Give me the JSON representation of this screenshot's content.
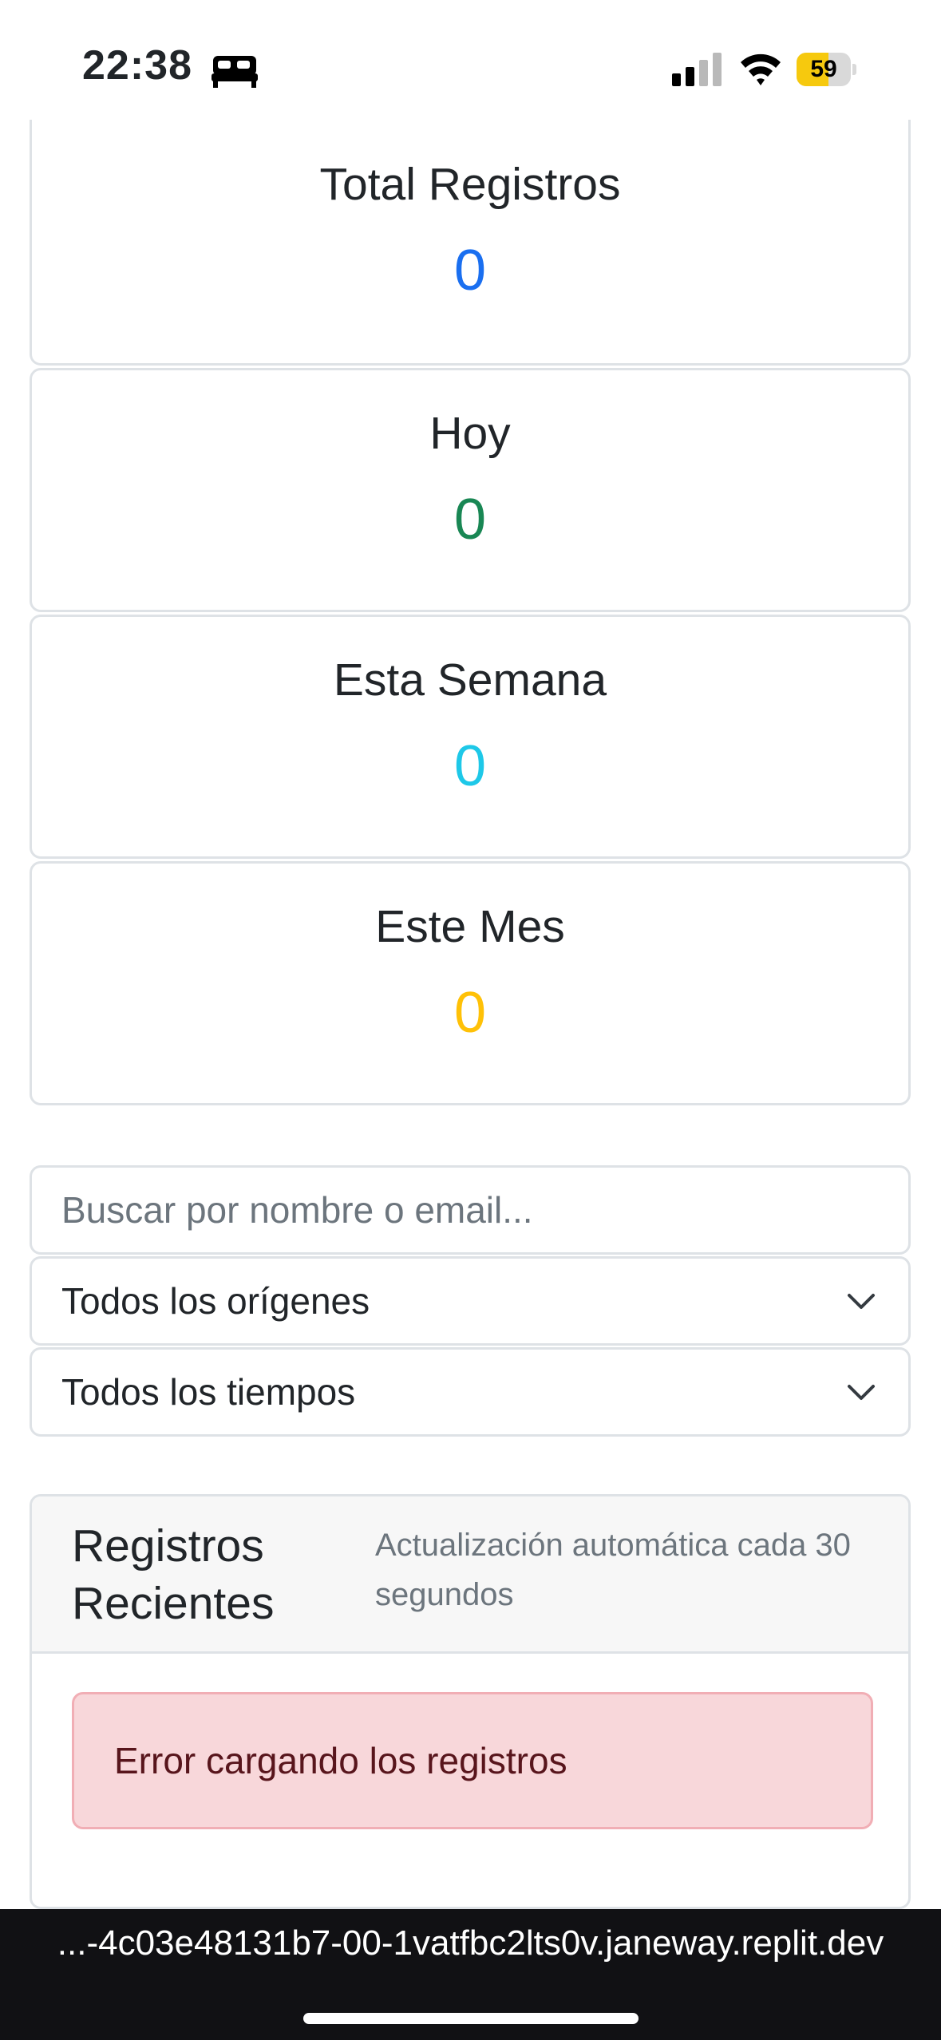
{
  "status_bar": {
    "time": "22:38",
    "battery_level": "59",
    "icons": [
      "bed-icon",
      "cellular-signal-icon",
      "wifi-icon",
      "battery-icon"
    ]
  },
  "stats": [
    {
      "label": "Total Registros",
      "value": "0",
      "color": "#1a6ff0"
    },
    {
      "label": "Hoy",
      "value": "0",
      "color": "#198754"
    },
    {
      "label": "Esta Semana",
      "value": "0",
      "color": "#1ec8e8"
    },
    {
      "label": "Este Mes",
      "value": "0",
      "color": "#ffc107"
    }
  ],
  "filters": {
    "search_placeholder": "Buscar por nombre o email...",
    "origin_select": "Todos los orígenes",
    "time_select": "Todos los tiempos"
  },
  "recent": {
    "title": "Registros Recientes",
    "subtitle": "Actualización automática cada 30 segundos",
    "error": "Error cargando los registros"
  },
  "browser": {
    "url": "...-4c03e48131b7-00-1vatfbc2lts0v.janeway.replit.dev"
  }
}
